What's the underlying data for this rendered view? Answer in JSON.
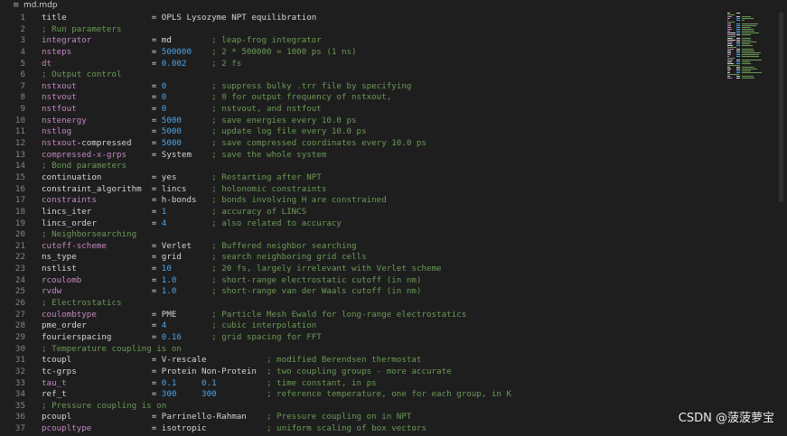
{
  "tab": {
    "file_icon": "file-icon",
    "file_name": "md.mdp"
  },
  "watermark": "CSDN @菠菠萝宝",
  "colors": {
    "background": "#1e1e1e",
    "line_number": "#858585",
    "key_plain": "#d4d4d4",
    "key_special": "#c586c0",
    "number": "#4aa4e8",
    "comment": "#6a9955"
  },
  "lines": [
    {
      "n": "1",
      "key": "title",
      "pad": "                 ",
      "eq": "= ",
      "val": "OPLS Lysozyme NPT equilibration",
      "vtype": "str",
      "kstyle": "plain",
      "comment": ""
    },
    {
      "n": "2",
      "key": "",
      "pad": "",
      "eq": "",
      "val": "",
      "vtype": "str",
      "kstyle": "plain",
      "comment": "; Run parameters",
      "section": true
    },
    {
      "n": "3",
      "key": "integrator",
      "pad": "            ",
      "eq": "= ",
      "val": "md        ",
      "vtype": "str",
      "kstyle": "special",
      "comment": "; leap-frog integrator"
    },
    {
      "n": "4",
      "key": "nsteps",
      "pad": "                ",
      "eq": "= ",
      "val": "500000    ",
      "vtype": "num",
      "kstyle": "special",
      "comment": "; 2 * 500000 = 1000 ps (1 ns)"
    },
    {
      "n": "5",
      "key": "dt",
      "pad": "                    ",
      "eq": "= ",
      "val": "0.002     ",
      "vtype": "num",
      "kstyle": "special",
      "comment": "; 2 fs"
    },
    {
      "n": "6",
      "key": "",
      "pad": "",
      "eq": "",
      "val": "",
      "vtype": "str",
      "kstyle": "plain",
      "comment": "; Output control",
      "section": true
    },
    {
      "n": "7",
      "key": "nstxout",
      "pad": "               ",
      "eq": "= ",
      "val": "0         ",
      "vtype": "num",
      "kstyle": "special",
      "comment": "; suppress bulky .trr file by specifying"
    },
    {
      "n": "8",
      "key": "nstvout",
      "pad": "               ",
      "eq": "= ",
      "val": "0         ",
      "vtype": "num",
      "kstyle": "special",
      "comment": "; 0 for output frequency of nstxout,"
    },
    {
      "n": "9",
      "key": "nstfout",
      "pad": "               ",
      "eq": "= ",
      "val": "0         ",
      "vtype": "num",
      "kstyle": "special",
      "comment": "; nstvout, and nstfout"
    },
    {
      "n": "10",
      "key": "nstenergy",
      "pad": "             ",
      "eq": "= ",
      "val": "5000      ",
      "vtype": "num",
      "kstyle": "special",
      "comment": "; save energies every 10.0 ps"
    },
    {
      "n": "11",
      "key": "nstlog",
      "pad": "                ",
      "eq": "= ",
      "val": "5000      ",
      "vtype": "num",
      "kstyle": "special",
      "comment": "; update log file every 10.0 ps"
    },
    {
      "n": "12",
      "key": "nstxout-compressed",
      "pad": "    ",
      "eq": "= ",
      "val": "5000      ",
      "vtype": "num",
      "kstyle": "mixed",
      "comment": "; save compressed coordinates every 10.0 ps"
    },
    {
      "n": "13",
      "key": "compressed-x-grps",
      "pad": "     ",
      "eq": "= ",
      "val": "System    ",
      "vtype": "str",
      "kstyle": "special",
      "comment": "; save the whole system"
    },
    {
      "n": "14",
      "key": "",
      "pad": "",
      "eq": "",
      "val": "",
      "vtype": "str",
      "kstyle": "plain",
      "comment": "; Bond parameters",
      "section": true
    },
    {
      "n": "15",
      "key": "continuation",
      "pad": "          ",
      "eq": "= ",
      "val": "yes       ",
      "vtype": "str",
      "kstyle": "plain",
      "comment": "; Restarting after NPT"
    },
    {
      "n": "16",
      "key": "constraint_algorithm",
      "pad": "  ",
      "eq": "= ",
      "val": "lincs     ",
      "vtype": "str",
      "kstyle": "plain",
      "comment": "; holonomic constraints"
    },
    {
      "n": "17",
      "key": "constraints",
      "pad": "           ",
      "eq": "= ",
      "val": "h-bonds   ",
      "vtype": "str",
      "kstyle": "special",
      "comment": "; bonds involving H are constrained"
    },
    {
      "n": "18",
      "key": "lincs_iter",
      "pad": "            ",
      "eq": "= ",
      "val": "1         ",
      "vtype": "num",
      "kstyle": "plain",
      "comment": "; accuracy of LINCS"
    },
    {
      "n": "19",
      "key": "lincs_order",
      "pad": "           ",
      "eq": "= ",
      "val": "4         ",
      "vtype": "num",
      "kstyle": "plain",
      "comment": "; also related to accuracy"
    },
    {
      "n": "20",
      "key": "",
      "pad": "",
      "eq": "",
      "val": "",
      "vtype": "str",
      "kstyle": "plain",
      "comment": "; Neighborsearching",
      "section": true
    },
    {
      "n": "21",
      "key": "cutoff-scheme",
      "pad": "         ",
      "eq": "= ",
      "val": "Verlet    ",
      "vtype": "str",
      "kstyle": "special",
      "comment": "; Buffered neighbor searching"
    },
    {
      "n": "22",
      "key": "ns_type",
      "pad": "               ",
      "eq": "= ",
      "val": "grid      ",
      "vtype": "str",
      "kstyle": "plain",
      "comment": "; search neighboring grid cells"
    },
    {
      "n": "23",
      "key": "nstlist",
      "pad": "               ",
      "eq": "= ",
      "val": "10        ",
      "vtype": "num",
      "kstyle": "plain",
      "comment": "; 20 fs, largely irrelevant with Verlet scheme"
    },
    {
      "n": "24",
      "key": "rcoulomb",
      "pad": "              ",
      "eq": "= ",
      "val": "1.0       ",
      "vtype": "num",
      "kstyle": "special",
      "comment": "; short-range electrostatic cutoff (in nm)"
    },
    {
      "n": "25",
      "key": "rvdw",
      "pad": "                  ",
      "eq": "= ",
      "val": "1.0       ",
      "vtype": "num",
      "kstyle": "special",
      "comment": "; short-range van der Waals cutoff (in nm)"
    },
    {
      "n": "26",
      "key": "",
      "pad": "",
      "eq": "",
      "val": "",
      "vtype": "str",
      "kstyle": "plain",
      "comment": "; Electrostatics",
      "section": true
    },
    {
      "n": "27",
      "key": "coulombtype",
      "pad": "           ",
      "eq": "= ",
      "val": "PME       ",
      "vtype": "str",
      "kstyle": "special",
      "comment": "; Particle Mesh Ewald for long-range electrostatics"
    },
    {
      "n": "28",
      "key": "pme_order",
      "pad": "             ",
      "eq": "= ",
      "val": "4         ",
      "vtype": "num",
      "kstyle": "plain",
      "comment": "; cubic interpolation"
    },
    {
      "n": "29",
      "key": "fourierspacing",
      "pad": "        ",
      "eq": "= ",
      "val": "0.16      ",
      "vtype": "num",
      "kstyle": "plain",
      "comment": "; grid spacing for FFT"
    },
    {
      "n": "30",
      "key": "",
      "pad": "",
      "eq": "",
      "val": "",
      "vtype": "str",
      "kstyle": "plain",
      "comment": "; Temperature coupling is on",
      "section": true
    },
    {
      "n": "31",
      "key": "tcoupl",
      "pad": "                ",
      "eq": "= ",
      "val": "V-rescale            ",
      "vtype": "str",
      "kstyle": "plain",
      "comment": "; modified Berendsen thermostat"
    },
    {
      "n": "32",
      "key": "tc-grps",
      "pad": "               ",
      "eq": "= ",
      "val": "Protein Non-Protein  ",
      "vtype": "str",
      "kstyle": "plain",
      "comment": "; two coupling groups - more accurate"
    },
    {
      "n": "33",
      "key": "tau_t",
      "pad": "                 ",
      "eq": "= ",
      "val": "0.1     0.1          ",
      "vtype": "num",
      "kstyle": "special",
      "comment": "; time constant, in ps"
    },
    {
      "n": "34",
      "key": "ref_t",
      "pad": "                 ",
      "eq": "= ",
      "val": "300     300          ",
      "vtype": "num",
      "kstyle": "plain",
      "comment": "; reference temperature, one for each group, in K"
    },
    {
      "n": "35",
      "key": "",
      "pad": "",
      "eq": "",
      "val": "",
      "vtype": "str",
      "kstyle": "plain",
      "comment": "; Pressure coupling is on",
      "section": true
    },
    {
      "n": "36",
      "key": "pcoupl",
      "pad": "                ",
      "eq": "= ",
      "val": "Parrinello-Rahman    ",
      "vtype": "str",
      "kstyle": "plain",
      "comment": "; Pressure coupling on in NPT"
    },
    {
      "n": "37",
      "key": "pcoupltype",
      "pad": "            ",
      "eq": "= ",
      "val": "isotropic            ",
      "vtype": "str",
      "kstyle": "special",
      "comment": "; uniform scaling of box vectors"
    }
  ]
}
